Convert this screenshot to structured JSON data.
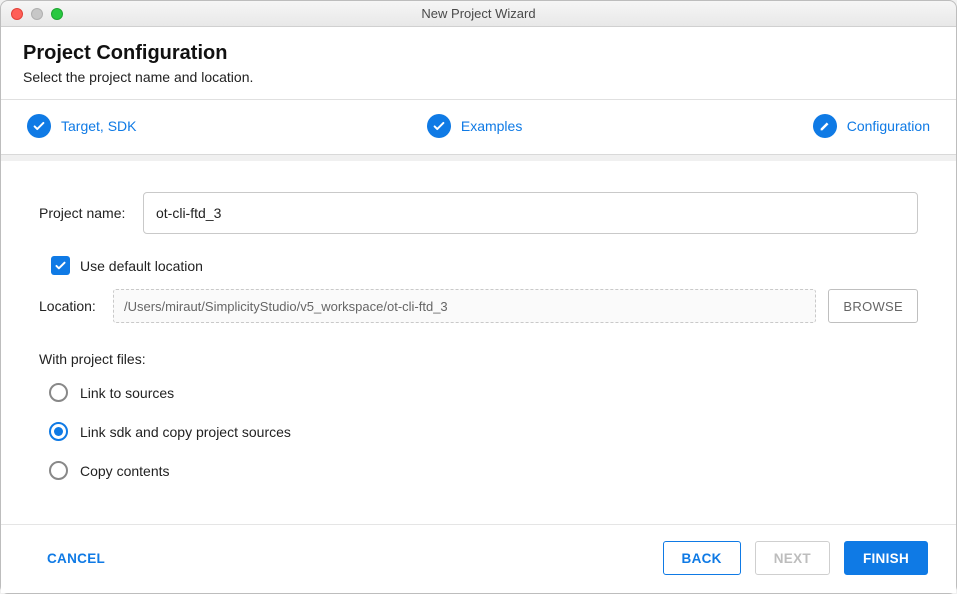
{
  "window": {
    "title": "New Project Wizard"
  },
  "header": {
    "title": "Project Configuration",
    "subtitle": "Select the project name and location."
  },
  "stepper": {
    "target": {
      "label": "Target, SDK",
      "icon": "check-icon"
    },
    "examples": {
      "label": "Examples",
      "icon": "check-icon"
    },
    "configuration": {
      "label": "Configuration",
      "icon": "pencil-icon"
    }
  },
  "form": {
    "project_name_label": "Project name:",
    "project_name_value": "ot-cli-ftd_3",
    "use_default_location_label": "Use default location",
    "use_default_location_checked": true,
    "location_label": "Location:",
    "location_value": "/Users/miraut/SimplicityStudio/v5_workspace/ot-cli-ftd_3",
    "browse_label": "BROWSE",
    "with_project_files_label": "With project files:",
    "radios": {
      "link_sources": "Link to sources",
      "link_sdk_copy": "Link sdk and copy project sources",
      "copy_contents": "Copy contents"
    },
    "selected_radio": "link_sdk_copy"
  },
  "footer": {
    "cancel": "CANCEL",
    "back": "BACK",
    "next": "NEXT",
    "finish": "FINISH"
  },
  "colors": {
    "accent": "#0f7ae5"
  }
}
